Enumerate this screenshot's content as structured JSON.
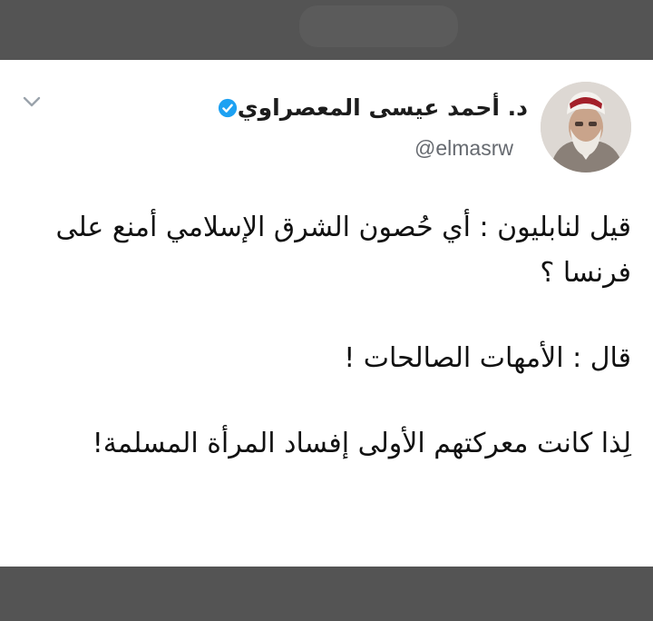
{
  "tweet": {
    "display_name": "د. أحمد عيسى المعصراوي",
    "handle": "@elmasrw",
    "verified": true,
    "paragraphs": [
      "قيل لنابليون : أي حُصون الشرق الإسلامي أمنع على فرنسا ؟",
      "قال : الأمهات الصالحات !",
      "لِذا كانت معركتهم الأولى إفساد المرأة المسلمة!"
    ]
  },
  "icons": {
    "menu": "chevron-down-icon",
    "verified": "verified-badge-icon"
  },
  "colors": {
    "background": "#545454",
    "card": "#ffffff",
    "text": "#111111",
    "handle": "#666a70",
    "verified": "#1da1f2",
    "chevron": "#9aa3ab"
  }
}
